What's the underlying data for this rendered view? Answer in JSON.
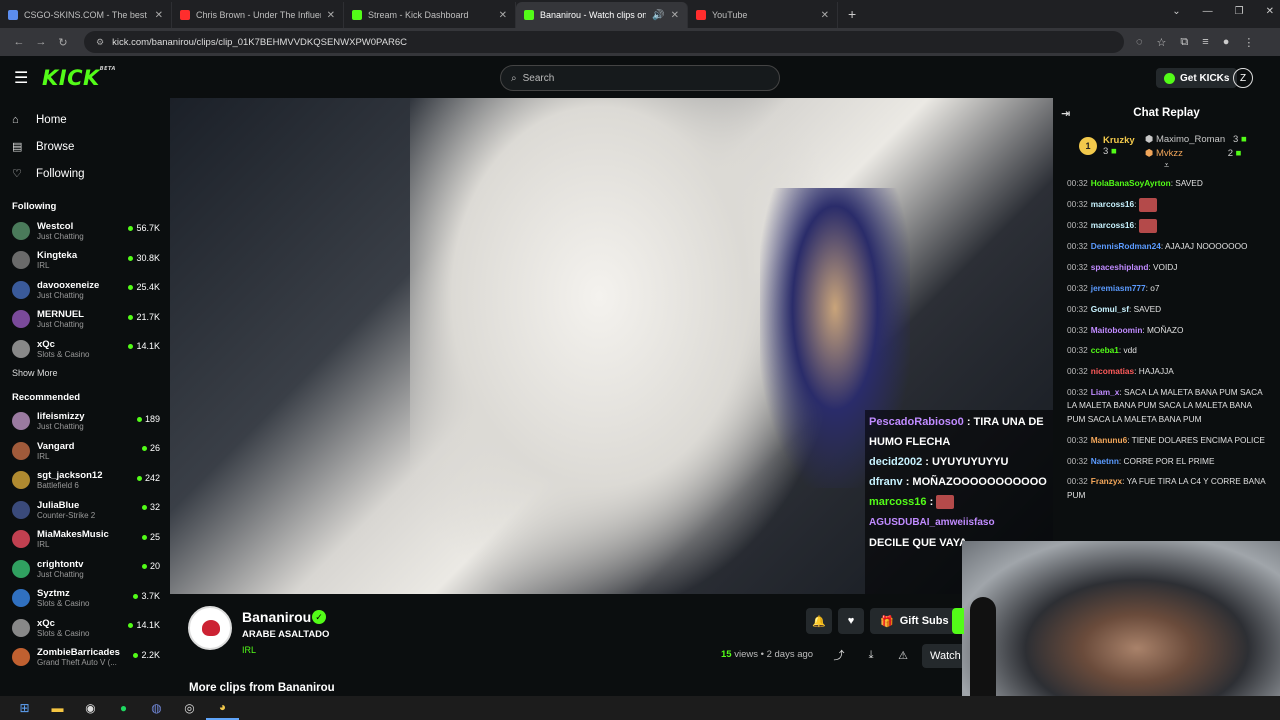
{
  "browser": {
    "tabs": [
      {
        "title": "CSGO-SKINS.COM - The best C",
        "favicon_color": "#5b8def"
      },
      {
        "title": "Chris Brown - Under The Influen",
        "favicon_color": "#ff2d2d"
      },
      {
        "title": "Stream - Kick Dashboard",
        "favicon_color": "#53fc18"
      },
      {
        "title": "Bananirou - Watch clips on",
        "favicon_color": "#53fc18"
      },
      {
        "title": "YouTube",
        "favicon_color": "#ff2d2d"
      }
    ],
    "url": "kick.com/bananirou/clips/clip_01K7BEHMVVDKQSENWXPW0PAR6C"
  },
  "header": {
    "logo": "KICK",
    "logo_sup": "BETA",
    "search_placeholder": "Search",
    "get_kicks_label": "Get KICKs",
    "profile_initial": "Z"
  },
  "sidebar": {
    "nav": [
      {
        "label": "Home",
        "icon": "home-icon"
      },
      {
        "label": "Browse",
        "icon": "browse-icon"
      },
      {
        "label": "Following",
        "icon": "heart-icon"
      }
    ],
    "following_title": "Following",
    "following": [
      {
        "name": "Westcol",
        "category": "Just Chatting",
        "viewers": "56.7K",
        "color": "#4a7a5a"
      },
      {
        "name": "Kingteka",
        "category": "IRL",
        "viewers": "30.8K",
        "color": "#6a6a6a"
      },
      {
        "name": "davooxeneize",
        "category": "Just Chatting",
        "viewers": "25.4K",
        "color": "#3a5a9a"
      },
      {
        "name": "MERNUEL",
        "category": "Just Chatting",
        "viewers": "21.7K",
        "color": "#7a4a9a"
      },
      {
        "name": "xQc",
        "category": "Slots & Casino",
        "viewers": "14.1K",
        "color": "#888888"
      }
    ],
    "show_more": "Show More",
    "recommended_title": "Recommended",
    "recommended": [
      {
        "name": "lifeismizzy",
        "category": "Just Chatting",
        "viewers": "189",
        "color": "#9a7aa0"
      },
      {
        "name": "Vangard",
        "category": "IRL",
        "viewers": "26",
        "color": "#a05a3a"
      },
      {
        "name": "sgt_jackson12",
        "category": "Battlefield 6",
        "viewers": "242",
        "color": "#b08a30"
      },
      {
        "name": "JuliaBlue",
        "category": "Counter-Strike 2",
        "viewers": "32",
        "color": "#3a4a7a"
      },
      {
        "name": "MiaMakesMusic",
        "category": "IRL",
        "viewers": "25",
        "color": "#c04050"
      },
      {
        "name": "crightontv",
        "category": "Just Chatting",
        "viewers": "20",
        "color": "#30a060"
      },
      {
        "name": "Syztmz",
        "category": "Slots & Casino",
        "viewers": "3.7K",
        "color": "#3070c0"
      },
      {
        "name": "xQc",
        "category": "Slots & Casino",
        "viewers": "14.1K",
        "color": "#888888"
      },
      {
        "name": "ZombieBarricades",
        "category": "Grand Theft Auto V (...",
        "viewers": "2.2K",
        "color": "#c06030"
      }
    ]
  },
  "video_overlay_chat": [
    {
      "user": "PescadoRabioso0",
      "text": ": TIRA UNA DE HUMO FLECHA"
    },
    {
      "user": "decid2002",
      "text": ": UYUYUYUYYU"
    },
    {
      "user": "dfranv",
      "text": ": MOÑAZOOOOOOOOOOO"
    },
    {
      "user": "marcoss16",
      "text": ":"
    },
    {
      "user": "AGUSDUBAI_amweiisfaso",
      "text": "DECILE QUE VAYA"
    }
  ],
  "chat": {
    "title": "Chat Replay",
    "leaderboard": {
      "first": {
        "rank": "1",
        "name": "Kruzky",
        "count": "3"
      },
      "second": {
        "name": "Maximo_Roman",
        "count": "3"
      },
      "third": {
        "name": "Mvkzz",
        "count": "2"
      }
    },
    "messages": [
      {
        "time": "00:32",
        "user": "HolaBanaSoyAyrton",
        "color": "#53fc18",
        "text": ": SAVED"
      },
      {
        "time": "00:32",
        "user": "marcoss16",
        "color": "#c8f3ff",
        "text": ":",
        "emote": true
      },
      {
        "time": "00:32",
        "user": "marcoss16",
        "color": "#c8f3ff",
        "text": ":",
        "emote": true
      },
      {
        "time": "00:32",
        "user": "DennisRodman24",
        "color": "#5b9bff",
        "text": ": AJAJAJ NOOOOOOO"
      },
      {
        "time": "00:32",
        "user": "spaceshipland",
        "color": "#c08bff",
        "text": ": VOIDJ"
      },
      {
        "time": "00:32",
        "user": "jeremiasm777",
        "color": "#5b9bff",
        "text": ": o7"
      },
      {
        "time": "00:32",
        "user": "Gomul_sf",
        "color": "#c8f3ff",
        "text": ": SAVED"
      },
      {
        "time": "00:32",
        "user": "Maitoboomin",
        "color": "#c08bff",
        "text": ": MOÑAZO"
      },
      {
        "time": "00:32",
        "user": "cceba1",
        "color": "#53fc18",
        "text": ": vdd"
      },
      {
        "time": "00:32",
        "user": "nicomatias",
        "color": "#ff5b5b",
        "text": ": HAJAJJA"
      },
      {
        "time": "00:32",
        "user": "Liam_x",
        "color": "#c08bff",
        "text": ": SACA LA MALETA BANA PUM SACA LA MALETA BANA PUM SACA LA MALETA BANA PUM SACA LA MALETA BANA PUM"
      },
      {
        "time": "00:32",
        "user": "Manunu6",
        "color": "#f2a65a",
        "text": ": TIENE DOLARES ENCIMA POLICE"
      },
      {
        "time": "00:32",
        "user": "Naetnn",
        "color": "#5b9bff",
        "text": ": CORRE POR EL PRIME"
      },
      {
        "time": "00:32",
        "user": "Franzyx",
        "color": "#f2a65a",
        "text": ": YA FUE TIRA LA C4 Y CORRE BANA PUM"
      }
    ]
  },
  "clip": {
    "channel": "Bananirou",
    "title": "ARABE ASALTADO",
    "category": "IRL",
    "gift_subs": "Gift Subs",
    "views": "15",
    "views_label": "views",
    "age": "• 2 days ago",
    "watch_label": "Watch",
    "more_clips": "More clips from Bananirou"
  }
}
